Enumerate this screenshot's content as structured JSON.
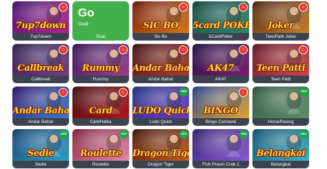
{
  "games": [
    {
      "caption": "7up7down",
      "logo": "7up7down",
      "badge": "hot",
      "bg": [
        "#3a0f6b",
        "#b7248d"
      ]
    },
    {
      "caption": "Goal",
      "title": "Go",
      "subtitle": "Goal",
      "badge": "none",
      "bg": [
        "#43b14b",
        "#43b14b"
      ]
    },
    {
      "caption": "Sic Bo",
      "logo": "SIC BO",
      "badge": "hot",
      "bg": [
        "#6b1206",
        "#d9781a"
      ]
    },
    {
      "caption": "5CardPoker",
      "logo": "5card POKER",
      "badge": "hot",
      "bg": [
        "#0b3f3a",
        "#2a8a6d"
      ]
    },
    {
      "caption": "TeenPatti Joker",
      "logo": "Joker",
      "badge": "hot",
      "bg": [
        "#4a1d0c",
        "#c6822c"
      ]
    },
    {
      "caption": "Callbreak",
      "logo": "Callbreak",
      "badge": "hot",
      "bg": [
        "#241b4a",
        "#7a3b8a"
      ]
    },
    {
      "caption": "Rummy",
      "logo": "Rummy",
      "badge": "hot",
      "bg": [
        "#2c0f55",
        "#a13d8e"
      ]
    },
    {
      "caption": "Andar Bahar",
      "logo": "Andar Bahar",
      "badge": "hot",
      "bg": [
        "#3a0b12",
        "#b23a2a"
      ]
    },
    {
      "caption": "AK47",
      "logo": "AK47",
      "badge": "hot",
      "bg": [
        "#1e0d3f",
        "#7a1e6e"
      ]
    },
    {
      "caption": "Teen Patti",
      "logo": "Teen Patti",
      "badge": "hot",
      "bg": [
        "#5a0f1f",
        "#d1474a"
      ]
    },
    {
      "caption": "Andar Bahar",
      "logo": "Andar Bahar",
      "badge": "hot",
      "bg": [
        "#2a0f60",
        "#3b7bd6"
      ]
    },
    {
      "caption": "CardHatka",
      "logo": "Card",
      "badge": "hot",
      "bg": [
        "#3a0a0a",
        "#b3161c"
      ]
    },
    {
      "caption": "Ludo Quick",
      "logo": "LUDO Quick",
      "badge": "new",
      "bg": [
        "#1a2d7a",
        "#6a3cc8"
      ]
    },
    {
      "caption": "Bingo Carnaval",
      "logo": "BINGO",
      "badge": "hot",
      "bg": [
        "#1b3d8a",
        "#e7a52c"
      ]
    },
    {
      "caption": "HorseRacing",
      "logo": "",
      "badge": "new",
      "bg": [
        "#2b4f3a",
        "#5b8f6a"
      ]
    },
    {
      "caption": "Sedie",
      "logo": "Sedie",
      "badge": "new",
      "bg": [
        "#0f3a6b",
        "#2fa0c8"
      ]
    },
    {
      "caption": "Roulette",
      "logo": "Roulette",
      "badge": "new",
      "bg": [
        "#7a1a3a",
        "#e68aa8"
      ]
    },
    {
      "caption": "Dragon Tiger",
      "logo": "Dragon Tiger",
      "badge": "new",
      "bg": [
        "#3a1206",
        "#c85a1a"
      ]
    },
    {
      "caption": "Fish Prawn Crab 2",
      "logo": "",
      "badge": "new",
      "bg": [
        "#2a1a6a",
        "#8a5ad6"
      ]
    },
    {
      "caption": "Belangkai",
      "logo": "Belangkai",
      "badge": "new",
      "bg": [
        "#0b4a6a",
        "#3bb2c8"
      ]
    }
  ],
  "badges": {
    "hot_color": "#e8322b",
    "new_color": "#1fa54a",
    "new_label": "NEW"
  }
}
